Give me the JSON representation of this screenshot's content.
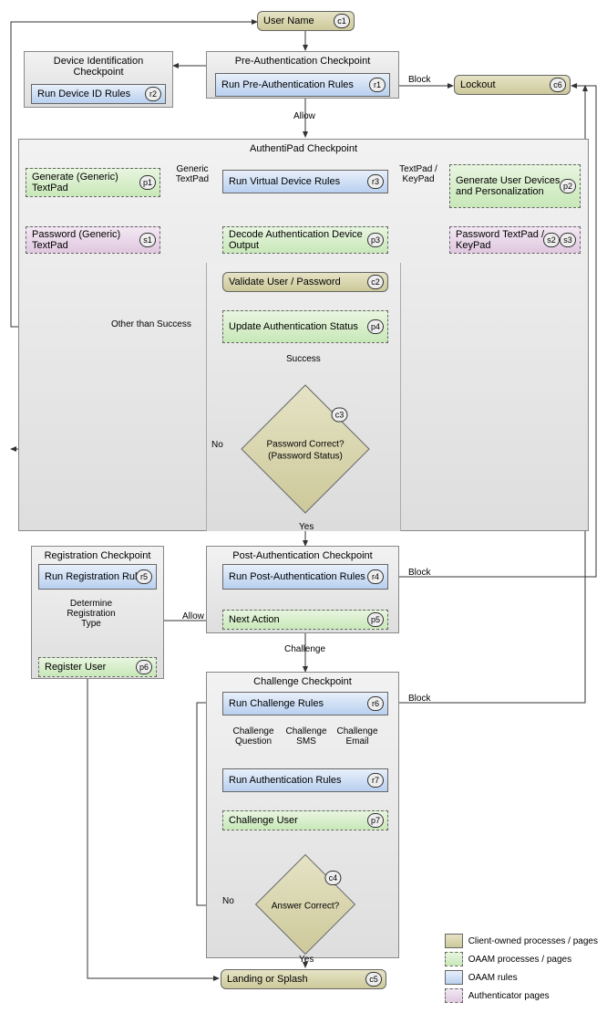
{
  "nodes": {
    "c1": "User Name",
    "c6": "Lockout",
    "c2": "Validate User / Password",
    "c5": "Landing or Splash",
    "r1": "Run Pre-Authentication Rules",
    "r2": "Run Device ID Rules",
    "r3": "Run Virtual Device Rules",
    "r4": "Run Post-Authentication Rules",
    "r5": "Run Registration Rule",
    "r6": "Run Challenge Rules",
    "r7": "Run Authentication Rules",
    "p1": "Generate (Generic) TextPad",
    "p2": "Generate User Devices and Personalization",
    "p3": "Decode Authentication Device Output",
    "p4": "Update Authentication Status",
    "p5": "Next Action",
    "p6": "Register User",
    "p7": "Challenge User",
    "s1": "Password (Generic) TextPad",
    "s2": "Password TextPad / KeyPad"
  },
  "tags": {
    "c1": "c1",
    "c2": "c2",
    "c3": "c3",
    "c4": "c4",
    "c5": "c5",
    "c6": "c6",
    "r1": "r1",
    "r2": "r2",
    "r3": "r3",
    "r4": "r4",
    "r5": "r5",
    "r6": "r6",
    "r7": "r7",
    "p1": "p1",
    "p2": "p2",
    "p3": "p3",
    "p4": "p4",
    "p5": "p5",
    "p6": "p6",
    "p7": "p7",
    "s1": "s1",
    "s2": "s2",
    "s3": "s3"
  },
  "checkpoints": {
    "devid": "Device Identification Checkpoint",
    "preauth": "Pre-Authentication Checkpoint",
    "authpad": "AuthentiPad Checkpoint",
    "postauth": "Post-Authentication Checkpoint",
    "reg": "Registration Checkpoint",
    "chal": "Challenge Checkpoint"
  },
  "decisions": {
    "c3": "Password Correct? (Password Status)",
    "c4": "Answer Correct?"
  },
  "edges": {
    "block": "Block",
    "allow": "Allow",
    "yes": "Yes",
    "no": "No",
    "success": "Success",
    "other": "Other than Success",
    "generic": "Generic TextPad",
    "tkp": "TextPad / KeyPad",
    "detreg": "Determine Registration Type",
    "challenge": "Challenge",
    "cq": "Challenge Question",
    "csms": "Challenge SMS",
    "cemail": "Challenge Email"
  },
  "legend": {
    "client": "Client-owned processes / pages",
    "oaamproc": "OAAM processes / pages",
    "oaamrule": "OAAM rules",
    "authpg": "Authenticator pages"
  }
}
